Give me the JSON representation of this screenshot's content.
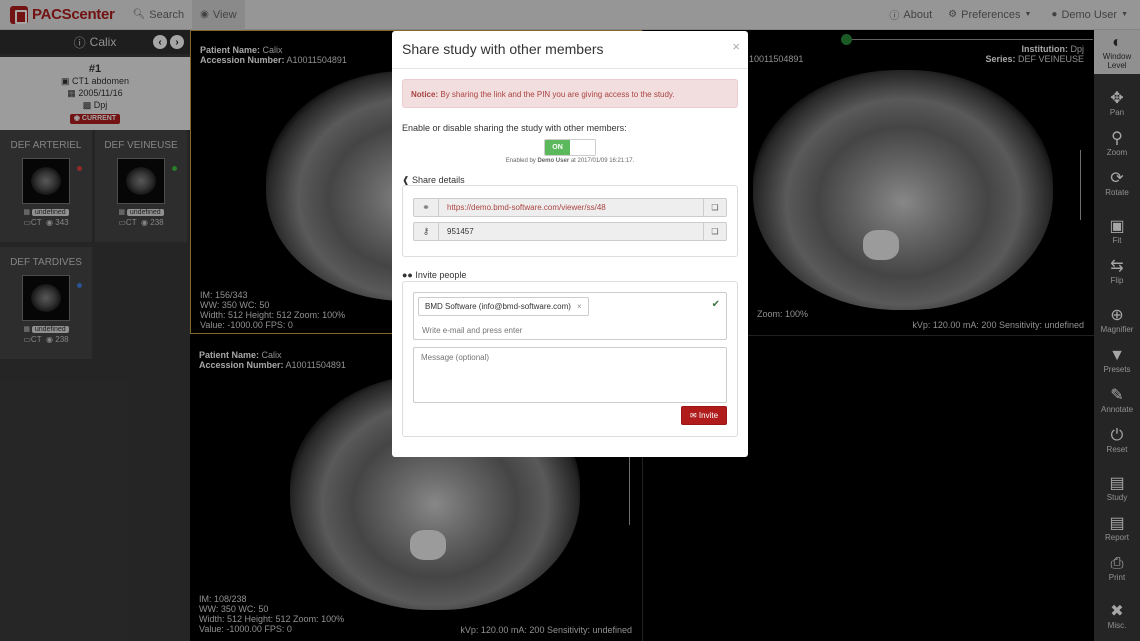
{
  "navbar": {
    "brand": "PACScenter",
    "search": "Search",
    "view": "View",
    "about": "About",
    "preferences": "Preferences",
    "user": "Demo User"
  },
  "patient_panel": {
    "patient_name": "Calix",
    "study": {
      "number": "#1",
      "description": "CT1 abdomen",
      "date": "2005/11/16",
      "institution": "Dpj",
      "badge": "CURRENT"
    },
    "series": [
      {
        "name": "DEF ARTERIEL",
        "date": "undefined",
        "modality": "CT",
        "count": "343",
        "dot_color": "#e04040"
      },
      {
        "name": "DEF VEINEUSE",
        "date": "undefined",
        "modality": "CT",
        "count": "238",
        "dot_color": "#40c040"
      },
      {
        "name": "DEF TARDIVES",
        "date": "undefined",
        "modality": "CT",
        "count": "238",
        "dot_color": "#4080e0"
      }
    ]
  },
  "viewports": {
    "top_left": {
      "patient_label": "Patient Name:",
      "patient": "Calix",
      "accession_label": "Accession Number:",
      "accession": "A10011504891",
      "im": "IM: 156/343",
      "ww_wc": "WW: 350  WC: 50",
      "dims": "Width: 512  Height: 512  Zoom: 100%",
      "value": "Value: -1000.00  FPS: 0"
    },
    "top_right": {
      "accession_partial": "10011504891",
      "institution_label": "Institution:",
      "institution": "Dpj",
      "series_label": "Series:",
      "series": "DEF VEINEUSE",
      "zoom": "Zoom: 100%",
      "exposure": "kVp: 120.00  mA: 200  Sensitivity: undefined"
    },
    "bottom_left": {
      "patient_label": "Patient Name:",
      "patient": "Calix",
      "accession_label": "Accession Number:",
      "accession": "A10011504891",
      "im": "IM: 108/238",
      "ww_wc": "WW: 350  WC: 50",
      "dims": "Width: 512  Height: 512  Zoom: 100%",
      "value": "Value: -1000.00  FPS: 0",
      "exposure": "kVp: 120.00  mA: 200  Sensitivity: undefined"
    }
  },
  "toolbar": [
    {
      "label": "Window Level",
      "icon": "contrast-icon"
    },
    {
      "label": "Pan",
      "icon": "arrows-icon"
    },
    {
      "label": "Zoom",
      "icon": "search-icon"
    },
    {
      "label": "Rotate",
      "icon": "rotate-icon"
    },
    {
      "label": "Fit",
      "icon": "fit-icon"
    },
    {
      "label": "Flip",
      "icon": "flip-icon"
    },
    {
      "label": "Magnifier",
      "icon": "magnifier-icon"
    },
    {
      "label": "Presets",
      "icon": "filter-icon"
    },
    {
      "label": "Annotate",
      "icon": "pencil-icon"
    },
    {
      "label": "Reset",
      "icon": "power-icon"
    },
    {
      "label": "Study",
      "icon": "study-icon"
    },
    {
      "label": "Report",
      "icon": "report-icon"
    },
    {
      "label": "Print",
      "icon": "print-icon"
    },
    {
      "label": "Misc.",
      "icon": "wrench-icon"
    }
  ],
  "modal": {
    "title": "Share study with other members",
    "close": "×",
    "notice_bold": "Notice:",
    "notice_text": "By sharing the link and the PIN you are giving access to the study.",
    "enable_label": "Enable or disable sharing the study with other members:",
    "toggle_on": "ON",
    "enabled_by_prefix": "Enabled by",
    "enabled_by_user": "Demo User",
    "enabled_by_suffix": "at 2017/01/09 16:21:17.",
    "share_details_label": "Share details",
    "share_link": "https://demo.bmd-software.com/viewer/ss/48",
    "pin": "951457",
    "invite_label": "Invite people",
    "invitee_tag": "BMD Software (info@bmd-software.com)",
    "email_placeholder": "Write e-mail and press enter",
    "message_placeholder": "Message (optional)",
    "invite_button": "Invite"
  }
}
